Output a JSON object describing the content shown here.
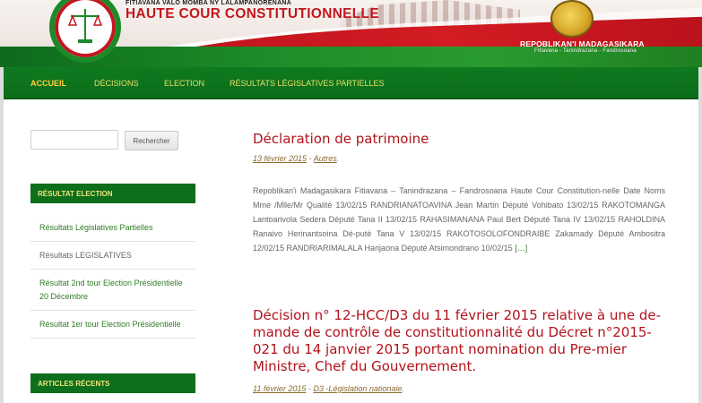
{
  "header": {
    "motto": "FITIAVANA VALO MOMBA NY LALAMPANORENANA",
    "title": "HAUTE COUR CONSTITUTIONNELLE",
    "republic": "REPOBLIKAN'I MADAGASIKARA",
    "republic_sub": "Fitiavana - Tanindrazana - Fandrosoana",
    "colors": {
      "green": "#0d6e1c",
      "red": "#c3161e",
      "gold": "#e7e06a"
    }
  },
  "nav": {
    "items": [
      {
        "label": "ACCUEIL",
        "active": true
      },
      {
        "label": "DÉCISIONS",
        "active": false
      },
      {
        "label": "ELECTION",
        "active": false
      },
      {
        "label": "RÉSULTATS LÉGISLATIVES PARTIELLES",
        "active": false
      }
    ]
  },
  "sidebar": {
    "search": {
      "placeholder": "",
      "button_label": "Rechercher"
    },
    "widgets": [
      {
        "heading": "RÉSULTAT ELECTION",
        "items": [
          "Résultats Législatives Partielles",
          "Résultats LEGISLATIVES",
          "Résultat 2nd tour Election Présidentielle 20 Décembre",
          "Résultat 1er tour Election Présidentielle"
        ]
      },
      {
        "heading": "ARTICLES RÉCENTS",
        "items": []
      }
    ]
  },
  "posts": [
    {
      "title": "Déclaration de patrimoine",
      "date": "13 février 2015",
      "category": "Autres",
      "excerpt": "Repoblikan'i Madagasikara Fitiavana – Tanindrazana – Fandrosoana Haute Cour Constitution-nelle    Date Noms Mme /Mlle/Mr Qualité 13/02/15 RANDRIANATOAVINA Jean Martin Député Vohibato 13/02/15 RAKOTOMANGA Lantoarivola Sedera Député Tana II 13/02/15 RAHASIMANANA Paul Bert Député Tana IV 13/02/15 RAHOLDINA Ranaivo Herinantsoina Dé-puté Tana V 13/02/15 RAKOTOSOLOFONDRAIBE Zakamady Député Ambositra 12/02/15 RANDRIARIMALALA Harijaona Député Atsimondrano 10/02/15",
      "more": "[…]"
    },
    {
      "title": "Décision n° 12-HCC/D3 du 11 février 2015 relative à une de-mande de contrôle de constitutionnalité du Décret n°2015-021 du 14 janvier 2015 portant nomination du Pre-mier Ministre, Chef du Gouvernement.",
      "date": "11 février 2015",
      "category": "D3 -Législation nationale"
    }
  ]
}
